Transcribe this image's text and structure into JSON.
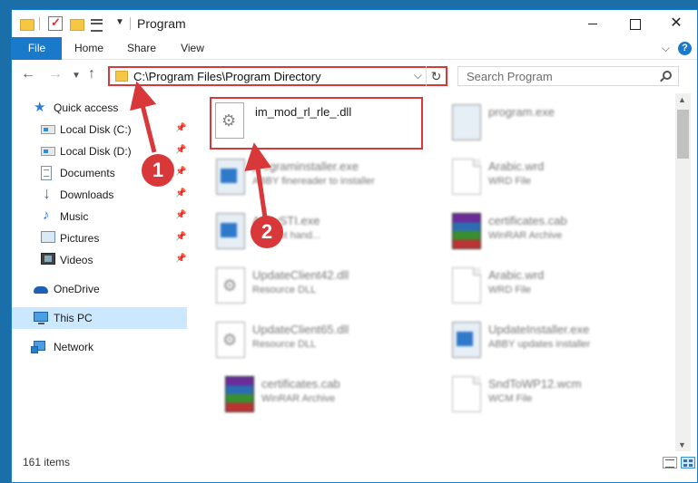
{
  "window": {
    "title": "Program"
  },
  "ribbon": {
    "tabs": [
      "File",
      "Home",
      "Share",
      "View"
    ]
  },
  "address": {
    "path": "C:\\Program Files\\Program Directory"
  },
  "search": {
    "placeholder": "Search Program"
  },
  "sidebar": {
    "quick_access": "Quick access",
    "items": [
      {
        "label": "Local Disk (C:)",
        "icon": "local-disk-icon"
      },
      {
        "label": "Local Disk (D:)",
        "icon": "local-disk-icon"
      },
      {
        "label": "Documents",
        "icon": "documents-icon"
      },
      {
        "label": "Downloads",
        "icon": "downloads-icon"
      },
      {
        "label": "Music",
        "icon": "music-icon"
      },
      {
        "label": "Pictures",
        "icon": "pictures-icon"
      },
      {
        "label": "Videos",
        "icon": "videos-icon"
      }
    ],
    "onedrive": "OneDrive",
    "this_pc": "This PC",
    "network": "Network"
  },
  "files": [
    {
      "name": "im_mod_rl_rle_.dll",
      "sub": "",
      "icon": "dll-icon",
      "highlighted": true
    },
    {
      "name": "program.exe",
      "sub": "",
      "icon": "exe-icon"
    },
    {
      "name": "programinstaller.exe",
      "sub": "ABBY finereader to installer",
      "icon": "setup-icon"
    },
    {
      "name": "Arabic.wrd",
      "sub": "WRD File",
      "icon": "blank-file-icon"
    },
    {
      "name": "AbbySTI.exe",
      "sub": "st event hand...",
      "icon": "setup-icon"
    },
    {
      "name": "certificates.cab",
      "sub": "WinRAR Archive",
      "icon": "winrar-icon"
    },
    {
      "name": "UpdateClient42.dll",
      "sub": "Resource DLL",
      "icon": "dll-icon"
    },
    {
      "name": "Arabic.wrd",
      "sub": "WRD File",
      "icon": "blank-file-icon"
    },
    {
      "name": "UpdateClient65.dll",
      "sub": "Resource DLL",
      "icon": "dll-icon"
    },
    {
      "name": "UpdateInstaller.exe",
      "sub": "ABBY updates installer",
      "icon": "setup-icon"
    },
    {
      "name": "certificates.cab",
      "sub": "WinRAR Archive",
      "icon": "winrar-icon"
    },
    {
      "name": "SndToWP12.wcm",
      "sub": "WCM File",
      "icon": "blank-file-icon"
    }
  ],
  "status": {
    "count": "161 items"
  },
  "callouts": [
    "1",
    "2"
  ],
  "colors": {
    "accent": "#1979ca",
    "highlight": "#d9383a"
  }
}
